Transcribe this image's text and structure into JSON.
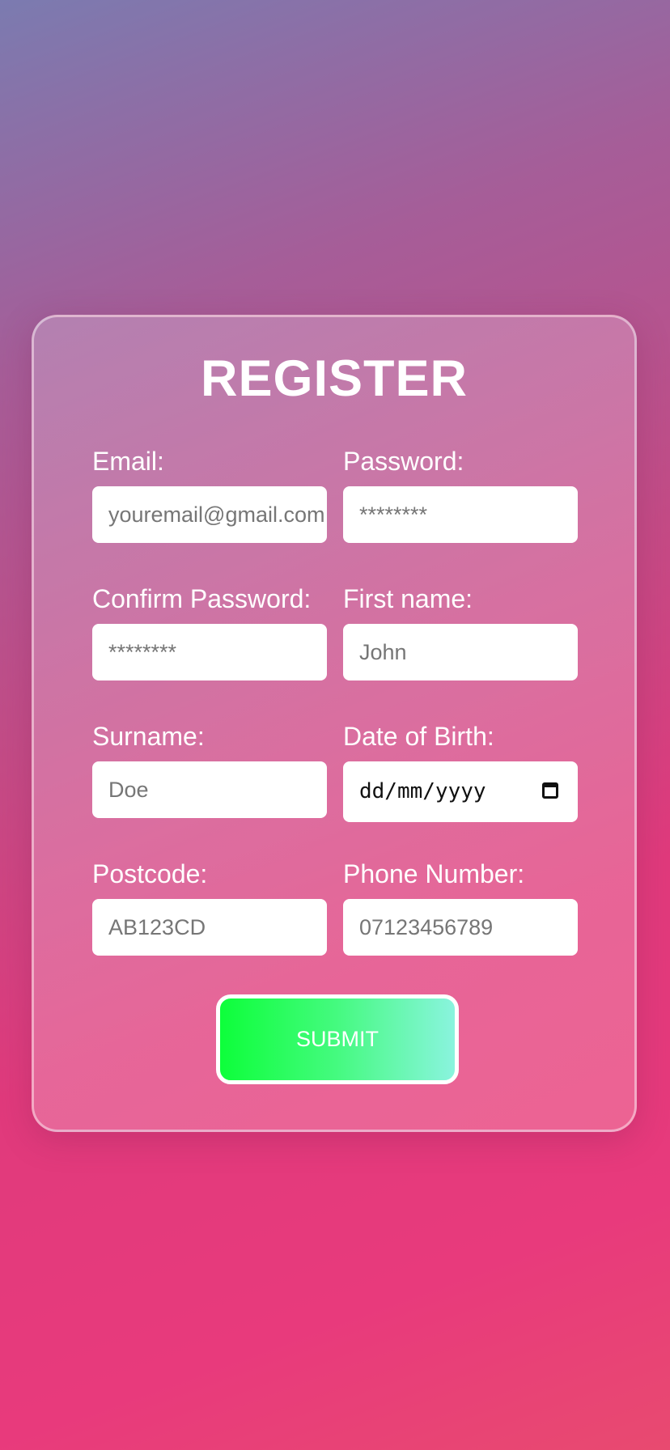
{
  "form": {
    "title": "REGISTER",
    "submit_label": "SUBMIT",
    "fields": {
      "email": {
        "label": "Email:",
        "placeholder": "youremail@gmail.com"
      },
      "password": {
        "label": "Password:",
        "placeholder": "********"
      },
      "confirm_password": {
        "label": "Confirm Password:",
        "placeholder": "********"
      },
      "first_name": {
        "label": "First name:",
        "placeholder": "John"
      },
      "surname": {
        "label": "Surname:",
        "placeholder": "Doe"
      },
      "dob": {
        "label": "Date of Birth:",
        "value": "dd/mm/yyyy"
      },
      "postcode": {
        "label": "Postcode:",
        "placeholder": "AB123CD"
      },
      "phone": {
        "label": "Phone Number:",
        "placeholder": "07123456789"
      }
    }
  },
  "icons": {
    "dob_picker": "calendar-icon"
  },
  "colors": {
    "submit_gradient_start": "#0dff3a",
    "submit_gradient_end": "#8af4de",
    "background_top": "#7b7bb0",
    "background_bottom": "#e83a7c"
  }
}
